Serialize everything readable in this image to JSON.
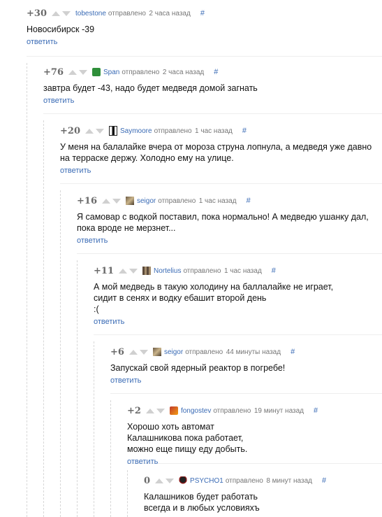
{
  "meta_sent": "отправлено",
  "reply_label": "ответить",
  "anchor_label": "#",
  "comments": [
    {
      "score": "+30",
      "user": "tobestone",
      "time": "2 часа назад",
      "text": "Новосибирск -39",
      "avatar": "none"
    },
    {
      "score": "+76",
      "user": "Span",
      "time": "2 часа назад",
      "text": "завтра будет -43, надо будет медведя домой загнать",
      "avatar": "green"
    },
    {
      "score": "+20",
      "user": "Saymoore",
      "time": "1 час назад",
      "text": "У меня на балалайке вчера от мороза струна лопнула, а медведя уже давно на терраске держу. Холодно ему на улице.",
      "avatar": "dark"
    },
    {
      "score": "+16",
      "user": "seigor",
      "time": "1 час назад",
      "text": "Я самовар с водкой поставил, пока нормально! А медведю ушанку дал, пока вроде не мерзнет...",
      "avatar": "photo"
    },
    {
      "score": "+11",
      "user": "Nortelius",
      "time": "1 час назад",
      "text": "А мой медведь в такую холодину на баллалайке не играет, сидит в сенях и водку ебашит второй день\n:(",
      "avatar": "pixel"
    },
    {
      "score": "+6",
      "user": "seigor",
      "time": "44 минуты назад",
      "text": "Запускай свой ядерный реактор в погребе!",
      "avatar": "photo"
    },
    {
      "score": "+2",
      "user": "fongostev",
      "time": "19 минут назад",
      "text": "Хорошо хоть автомат Калашникова пока работает, можно еще пищу еду добыть.",
      "avatar": "red"
    },
    {
      "score": "0",
      "user": "PSYCHO1",
      "time": "8 минут назад",
      "text": "Калашников будет работать всегда и в любых условияхъ",
      "avatar": "black"
    }
  ]
}
